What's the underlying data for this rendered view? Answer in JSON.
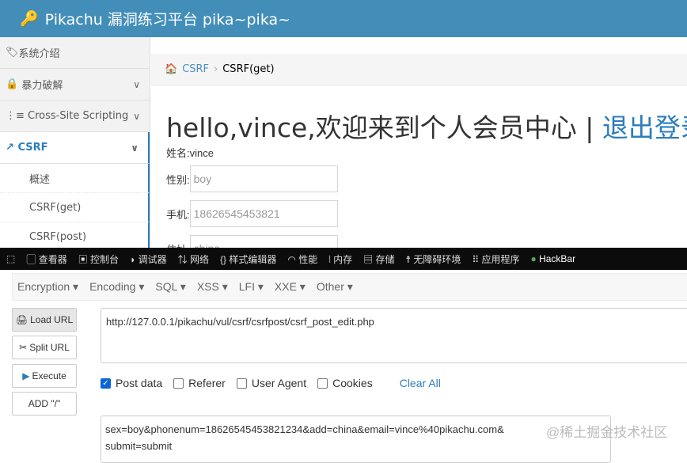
{
  "header": {
    "title": "Pikachu 漏洞练习平台 pika~pika~"
  },
  "sidebar": {
    "items": [
      {
        "label": "系统介绍"
      },
      {
        "label": "暴力破解"
      },
      {
        "label": "Cross-Site Scripting"
      },
      {
        "label": "CSRF"
      }
    ],
    "sub": [
      "概述",
      "CSRF(get)",
      "CSRF(post)"
    ]
  },
  "breadcrumb": {
    "parent": "CSRF",
    "current": "CSRF(get)"
  },
  "main": {
    "greeting": "hello,vince,欢迎来到个人会员中心 | ",
    "logout": "退出登录",
    "name": "姓名:vince",
    "sex_label": "性别:",
    "sex": "boy",
    "phone_label": "手机:",
    "phone": "18626545453821",
    "addr_label": "住址:",
    "addr": "china"
  },
  "devtools": {
    "tabs": [
      "查看器",
      "控制台",
      "调试器",
      "网络",
      "样式编辑器",
      "性能",
      "内存",
      "存储",
      "无障碍环境",
      "应用程序",
      "HackBar"
    ]
  },
  "hackbar": {
    "menu": [
      "Encryption",
      "Encoding",
      "SQL",
      "XSS",
      "LFI",
      "XXE",
      "Other"
    ],
    "buttons": [
      "Load URL",
      "Split URL",
      "Execute",
      "ADD \"/\""
    ],
    "url": "http://127.0.0.1/pikachu/vul/csrf/csrfpost/csrf_post_edit.php",
    "checks": [
      "Post data",
      "Referer",
      "User Agent",
      "Cookies"
    ],
    "clear": "Clear All",
    "post1": "sex=boy&phonenum=18626545453821234&add=china&email=vince%40pikachu.com&",
    "post2": "submit=submit"
  },
  "watermark": "@稀土掘金技术社区"
}
